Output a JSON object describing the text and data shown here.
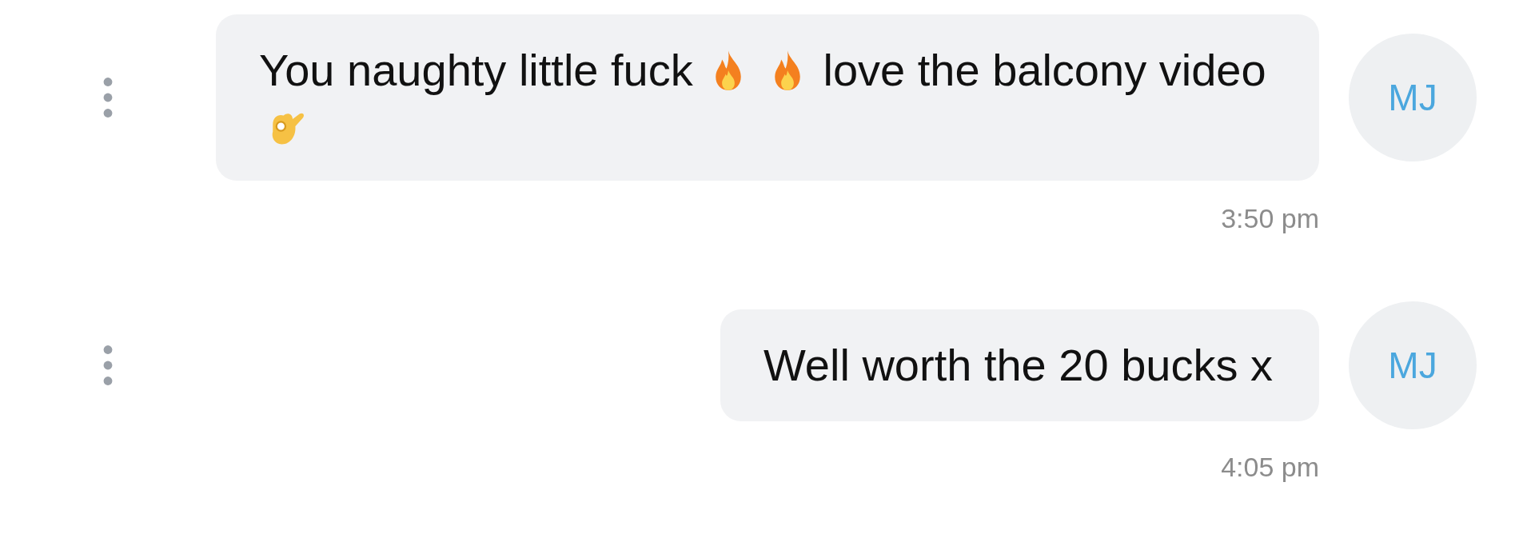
{
  "messages": [
    {
      "avatar": "MJ",
      "time": "3:50 pm",
      "parts": [
        {
          "kind": "text",
          "text": "You naughty little fuck"
        },
        {
          "kind": "fire"
        },
        {
          "kind": "fire"
        },
        {
          "kind": "text",
          "text": "love the balcony video"
        },
        {
          "kind": "ok_hand"
        }
      ]
    },
    {
      "avatar": "MJ",
      "time": "4:05 pm",
      "parts": [
        {
          "kind": "text",
          "text": "Well worth the 20 bucks x"
        }
      ]
    }
  ]
}
